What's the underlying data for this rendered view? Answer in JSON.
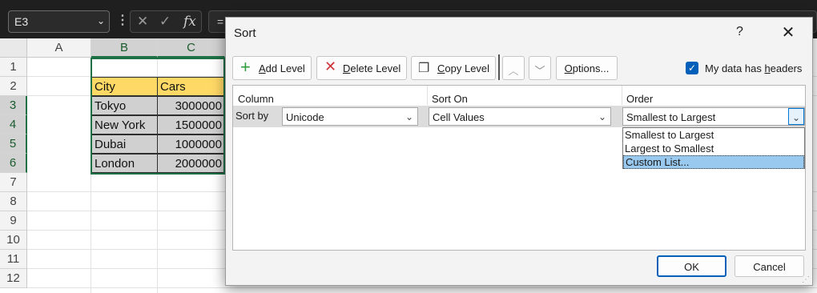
{
  "namebox": {
    "value": "E3"
  },
  "formula_bar": {
    "fx": "fx",
    "value": "="
  },
  "sheet": {
    "columns": [
      "A",
      "B",
      "C"
    ],
    "rows": [
      "1",
      "2",
      "3",
      "4",
      "5",
      "6",
      "7",
      "8",
      "9",
      "10",
      "11",
      "12"
    ],
    "headers": [
      "City",
      "Cars"
    ],
    "data": [
      {
        "city": "Tokyo",
        "cars": "3000000"
      },
      {
        "city": "New York",
        "cars": "1500000"
      },
      {
        "city": "Dubai",
        "cars": "1000000"
      },
      {
        "city": "London",
        "cars": "2000000"
      }
    ]
  },
  "dialog": {
    "title": "Sort",
    "help": "?",
    "close": "✕",
    "toolbar": {
      "add_level_pre": "",
      "add_level_u": "A",
      "add_level_post": "dd Level",
      "delete_level_u": "D",
      "delete_level_post": "elete Level",
      "copy_level_u": "C",
      "copy_level_post": "opy Level",
      "options_u": "O",
      "options_post": "ptions..."
    },
    "headers_checkbox": {
      "pre": "My data has ",
      "u": "h",
      "post": "eaders",
      "checked": true
    },
    "list": {
      "col_column": "Column",
      "col_sort_on": "Sort On",
      "col_order": "Order",
      "row_label": "Sort by",
      "column_value": "Unicode",
      "sort_on_value": "Cell Values",
      "order_value": "Smallest to Largest",
      "order_options": [
        "Smallest to Largest",
        "Largest to Smallest",
        "Custom List..."
      ],
      "highlighted_option": "Custom List..."
    },
    "ok": "OK",
    "cancel": "Cancel"
  },
  "colors": {
    "accent": "#005fb8",
    "header_fill": "#ffd966",
    "data_fill": "#d0d0d0",
    "excel_green": "#1e7145"
  }
}
